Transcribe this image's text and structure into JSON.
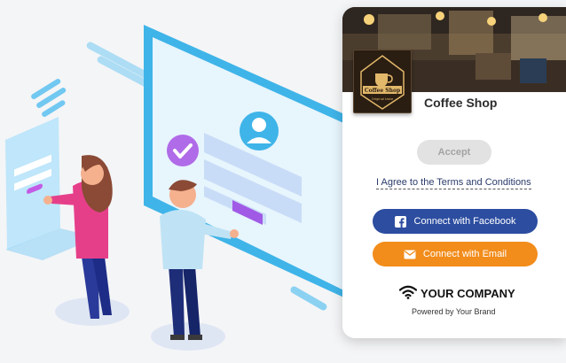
{
  "portal": {
    "shop_name": "Coffee Shop",
    "logo_title": "Coffee Shop",
    "logo_subtitle": "Original taste",
    "accept_label": "Accept",
    "terms_text": "I Agree to the Terms and Conditions",
    "facebook_label": "Connect with Facebook",
    "email_label": "Connect with Email",
    "company_name": "YOUR COMPANY",
    "powered_by": "Powered by Your Brand"
  },
  "colors": {
    "facebook": "#2c4da0",
    "email": "#f28c1b",
    "accent_blue": "#3fb4e8",
    "accent_purple": "#a86ae6"
  },
  "icons": [
    "check-icon",
    "user-avatar-icon",
    "facebook-icon",
    "envelope-icon",
    "wifi-icon"
  ]
}
